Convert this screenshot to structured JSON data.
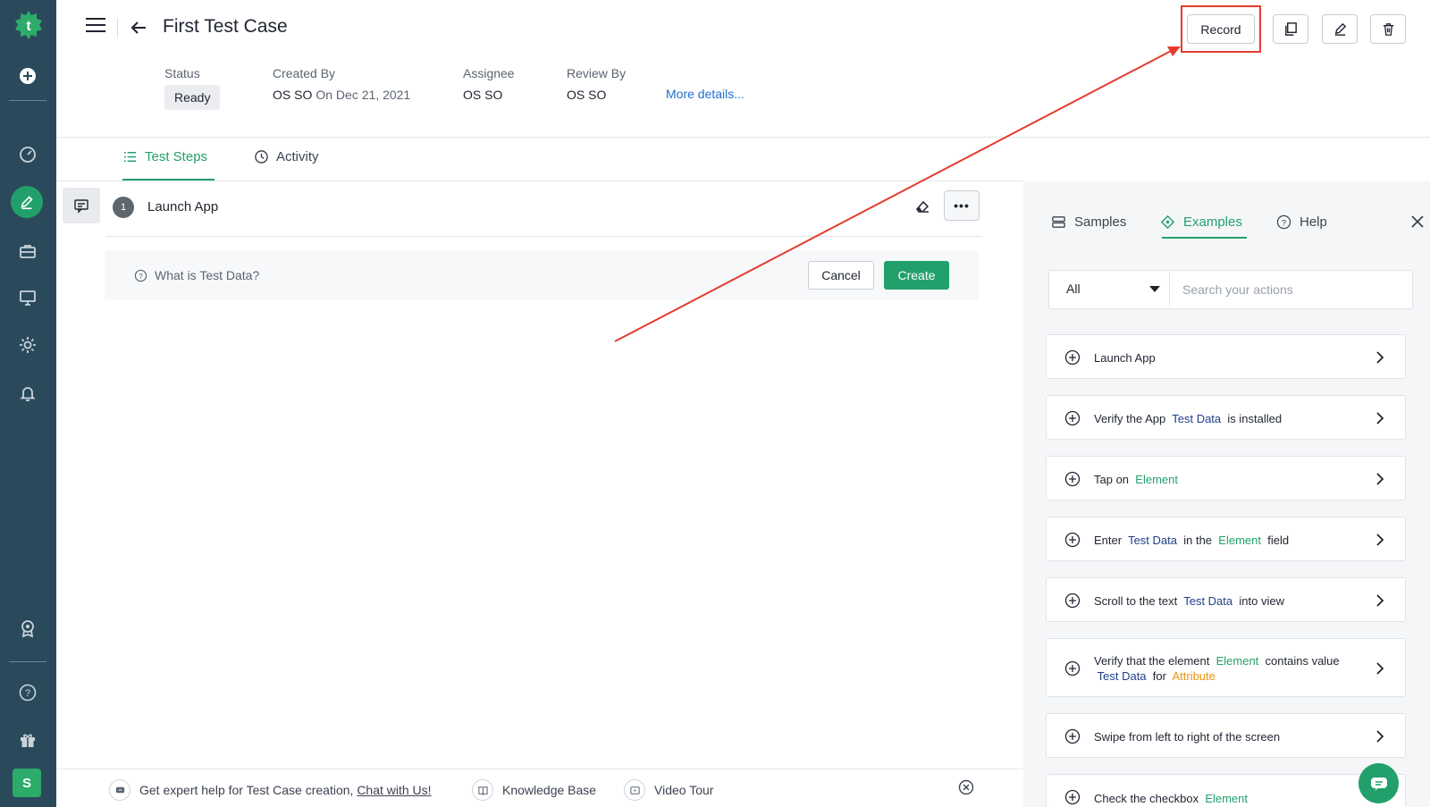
{
  "header": {
    "title": "First Test Case",
    "record_label": "Record"
  },
  "meta": {
    "status_label": "Status",
    "status_value": "Ready",
    "created_by_label": "Created By",
    "created_by_value": "OS SO",
    "created_on": "On Dec 21, 2021",
    "assignee_label": "Assignee",
    "assignee_value": "OS SO",
    "review_by_label": "Review By",
    "review_by_value": "OS SO",
    "more_details": "More details..."
  },
  "tabs": {
    "test_steps": "Test Steps",
    "activity": "Activity"
  },
  "step": {
    "number": "1",
    "text": "Launch App",
    "more": "•••"
  },
  "test_data": {
    "help": "What is Test Data?",
    "cancel": "Cancel",
    "create": "Create"
  },
  "help_bar": {
    "expert_text": "Get expert help for Test Case creation,",
    "chat_link": "Chat with Us!",
    "knowledge_base": "Knowledge Base",
    "video_tour": "Video Tour"
  },
  "right_panel": {
    "tabs": {
      "samples": "Samples",
      "examples": "Examples",
      "help": "Help"
    },
    "filter_value": "All",
    "search_placeholder": "Search your actions",
    "cards": {
      "c1": {
        "t1": "Launch App"
      },
      "c2": {
        "t1": "Verify the App",
        "t2": "Test Data",
        "t3": "is installed"
      },
      "c3": {
        "t1": "Tap on",
        "t2": "Element"
      },
      "c4": {
        "t1": "Enter",
        "t2": "Test Data",
        "t3": "in the",
        "t4": "Element",
        "t5": "field"
      },
      "c5": {
        "t1": "Scroll to the text",
        "t2": "Test Data",
        "t3": "into view"
      },
      "c6": {
        "t1": "Verify that the element",
        "t2": "Element",
        "t3": "contains value",
        "t4": "Test Data",
        "t5": "for",
        "t6": "Attribute"
      },
      "c7": {
        "t1": "Swipe from left to right of the screen"
      },
      "c8": {
        "t1": "Check the checkbox",
        "t2": "Element"
      }
    }
  },
  "sidebar": {
    "avatar": "S"
  },
  "colors": {
    "sidebar_bg": "#2a4a5c",
    "accent_green": "#22a06b",
    "link_blue": "#1f6fd1",
    "test_data_token": "#1f3f8a",
    "attribute_token": "#e8940c",
    "highlight_red": "#e53b2f"
  },
  "icons": [
    "testsigma-logo-icon",
    "add-circle-icon",
    "dashboard-icon",
    "edit-icon",
    "briefcase-icon",
    "monitor-icon",
    "settings-gear-icon",
    "bell-icon",
    "award-icon",
    "help-icon",
    "gift-icon",
    "hamburger-icon",
    "back-arrow-icon",
    "copy-icon",
    "pencil-icon",
    "trash-icon",
    "list-icon",
    "clock-icon",
    "comment-icon",
    "eraser-icon",
    "question-icon",
    "samples-icon",
    "examples-icon",
    "close-icon",
    "plus-circle-icon",
    "chevron-right-icon",
    "chat-icon",
    "book-icon",
    "video-icon"
  ]
}
